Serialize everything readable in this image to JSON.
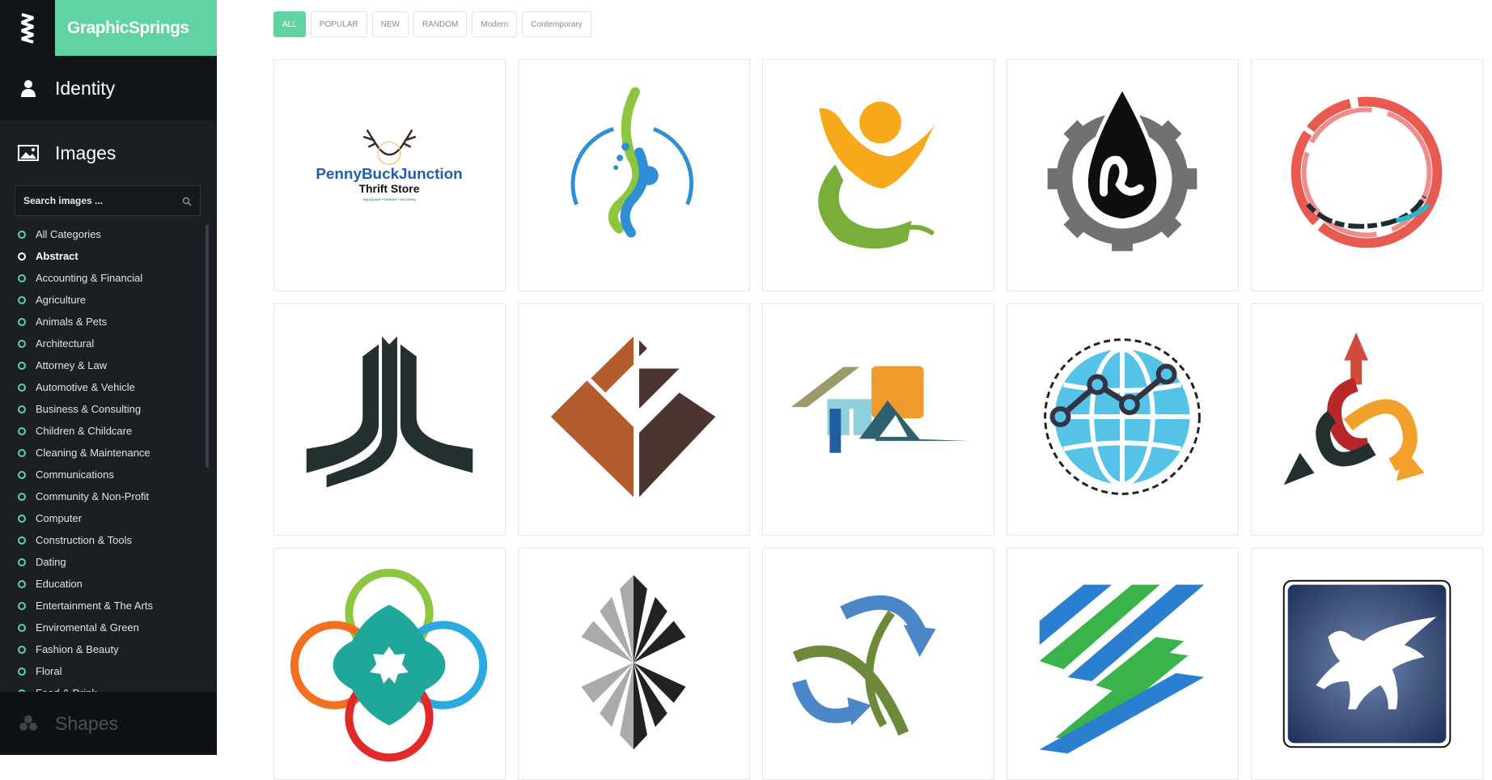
{
  "brand": {
    "name": "GraphicSprings"
  },
  "nav": {
    "identity": {
      "label": "Identity",
      "icon": "user-icon"
    },
    "images": {
      "label": "Images",
      "icon": "image-icon"
    },
    "shapes": {
      "label": "Shapes",
      "icon": "shapes-icon"
    }
  },
  "search": {
    "placeholder": "Search images ..."
  },
  "categories": [
    "All Categories",
    "Abstract",
    "Accounting & Financial",
    "Agriculture",
    "Animals & Pets",
    "Architectural",
    "Attorney & Law",
    "Automotive & Vehicle",
    "Business & Consulting",
    "Children & Childcare",
    "Cleaning & Maintenance",
    "Communications",
    "Community & Non-Profit",
    "Computer",
    "Construction & Tools",
    "Dating",
    "Education",
    "Entertainment & The Arts",
    "Enviromental & Green",
    "Fashion & Beauty",
    "Floral",
    "Food & Drink"
  ],
  "active_category": "Abstract",
  "filters": [
    "ALL",
    "POPULAR",
    "NEW",
    "RANDOM",
    "Modern",
    "Contemporary"
  ],
  "active_filter": "ALL",
  "logos": {
    "pennybuck": {
      "line1": "PennyBuckJunction",
      "line2": "Thrift Store",
      "tagline": "repurpose • restore • recovery"
    }
  },
  "colors": {
    "accent": "#5fd3a1",
    "sidebar": "#1b1f24"
  }
}
